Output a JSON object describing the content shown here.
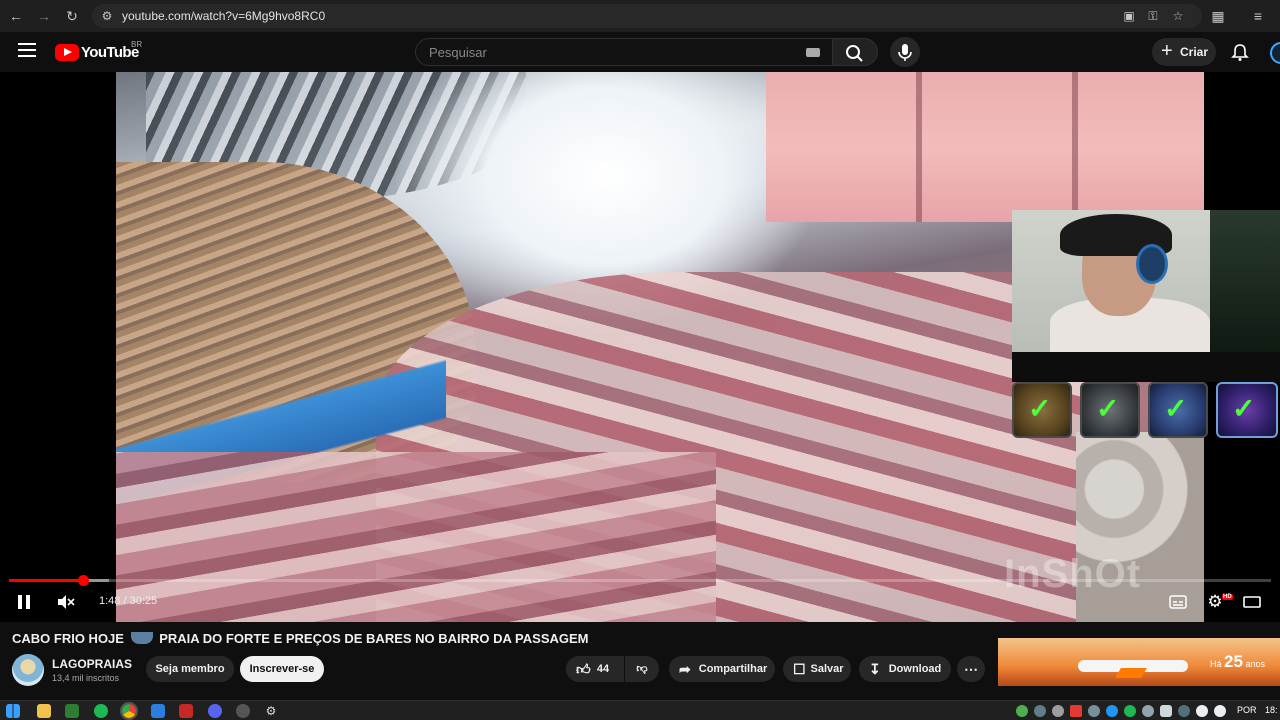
{
  "browser": {
    "url": "youtube.com/watch?v=6Mg9hvo8RC0"
  },
  "header": {
    "logo_text": "YouTube",
    "country_code": "BR",
    "search_placeholder": "Pesquisar",
    "create_label": "Criar"
  },
  "player": {
    "time_display": "1:48 / 30:25",
    "progress_played_fraction": 0.059,
    "progress_buffered_fraction": 0.079,
    "watermark": "InShOt",
    "hd_badge": "HD",
    "icons": {
      "pause": "pause-icon",
      "mute": "volume-muted-icon",
      "subtitles": "subtitles-icon",
      "settings": "gear-icon",
      "theater": "theater-mode-icon"
    }
  },
  "video": {
    "title": "CABO FRIO HOJE",
    "title_rest": "PRAIA DO FORTE E PREÇOS DE BARES NO BAIRRO DA PASSAGEM"
  },
  "channel": {
    "name": "LAGOPRAIAS",
    "subscribers": "13,4 mil inscritos",
    "member_label": "Seja membro",
    "subscribe_label": "Inscrever-se"
  },
  "actions": {
    "like_count": "44",
    "share_label": "Compartilhar",
    "save_label": "Salvar",
    "download_label": "Download"
  },
  "ad": {
    "headline_number": "25",
    "headline_unit": "anos",
    "headline_prefix": "Há"
  },
  "taskbar": {
    "language": "POR",
    "clock": "18:"
  }
}
